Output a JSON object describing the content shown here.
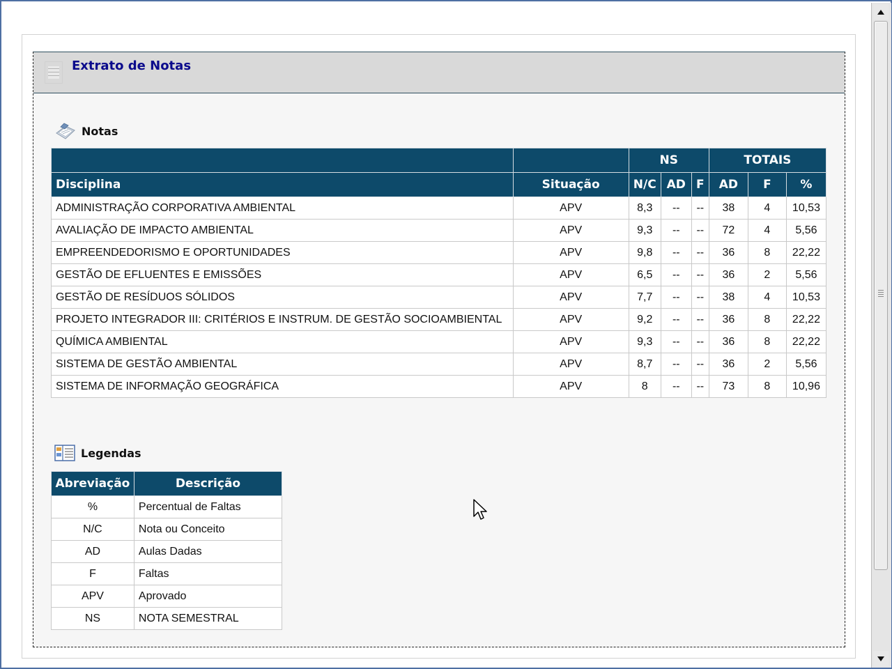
{
  "header": {
    "title": "Extrato de Notas"
  },
  "notas": {
    "section_label": "Notas",
    "group_headers": {
      "blank_a": "",
      "blank_b": "",
      "ns": "NS",
      "totais": "TOTAIS"
    },
    "columns": [
      "Disciplina",
      "Situação",
      "N/C",
      "AD",
      "F",
      "AD",
      "F",
      "%"
    ],
    "rows": [
      [
        "ADMINISTRAÇÃO CORPORATIVA AMBIENTAL",
        "APV",
        "8,3",
        "--",
        "--",
        "38",
        "4",
        "10,53"
      ],
      [
        "AVALIAÇÃO DE IMPACTO AMBIENTAL",
        "APV",
        "9,3",
        "--",
        "--",
        "72",
        "4",
        "5,56"
      ],
      [
        "EMPREENDEDORISMO E OPORTUNIDADES",
        "APV",
        "9,8",
        "--",
        "--",
        "36",
        "8",
        "22,22"
      ],
      [
        "GESTÃO DE EFLUENTES E EMISSÕES",
        "APV",
        "6,5",
        "--",
        "--",
        "36",
        "2",
        "5,56"
      ],
      [
        "GESTÃO DE RESÍDUOS SÓLIDOS",
        "APV",
        "7,7",
        "--",
        "--",
        "38",
        "4",
        "10,53"
      ],
      [
        "PROJETO INTEGRADOR III: CRITÉRIOS E INSTRUM. DE GESTÃO SOCIOAMBIENTAL",
        "APV",
        "9,2",
        "--",
        "--",
        "36",
        "8",
        "22,22"
      ],
      [
        "QUÍMICA AMBIENTAL",
        "APV",
        "9,3",
        "--",
        "--",
        "36",
        "8",
        "22,22"
      ],
      [
        "SISTEMA DE GESTÃO AMBIENTAL",
        "APV",
        "8,7",
        "--",
        "--",
        "36",
        "2",
        "5,56"
      ],
      [
        "SISTEMA DE INFORMAÇÃO GEOGRÁFICA",
        "APV",
        "8",
        "--",
        "--",
        "73",
        "8",
        "10,96"
      ]
    ]
  },
  "legendas": {
    "section_label": "Legendas",
    "columns": [
      "Abreviação",
      "Descrição"
    ],
    "rows": [
      [
        "%",
        "Percentual de Faltas"
      ],
      [
        "N/C",
        "Nota ou Conceito"
      ],
      [
        "AD",
        "Aulas Dadas"
      ],
      [
        "F",
        "Faltas"
      ],
      [
        "APV",
        "Aprovado"
      ],
      [
        "NS",
        "NOTA SEMESTRAL"
      ]
    ]
  },
  "icons": {
    "header": "document-icon",
    "notas": "notes-icon",
    "legendas": "legend-icon",
    "scroll_up": "scroll-up-arrow-icon",
    "scroll_down": "scroll-down-arrow-icon",
    "cursor": "mouse-pointer-icon"
  },
  "colors": {
    "table_header_bg": "#0d4a6a",
    "title_text": "#0b0b8c",
    "header_bar_bg": "#d9d9d9",
    "window_border": "#4e6fa3"
  }
}
